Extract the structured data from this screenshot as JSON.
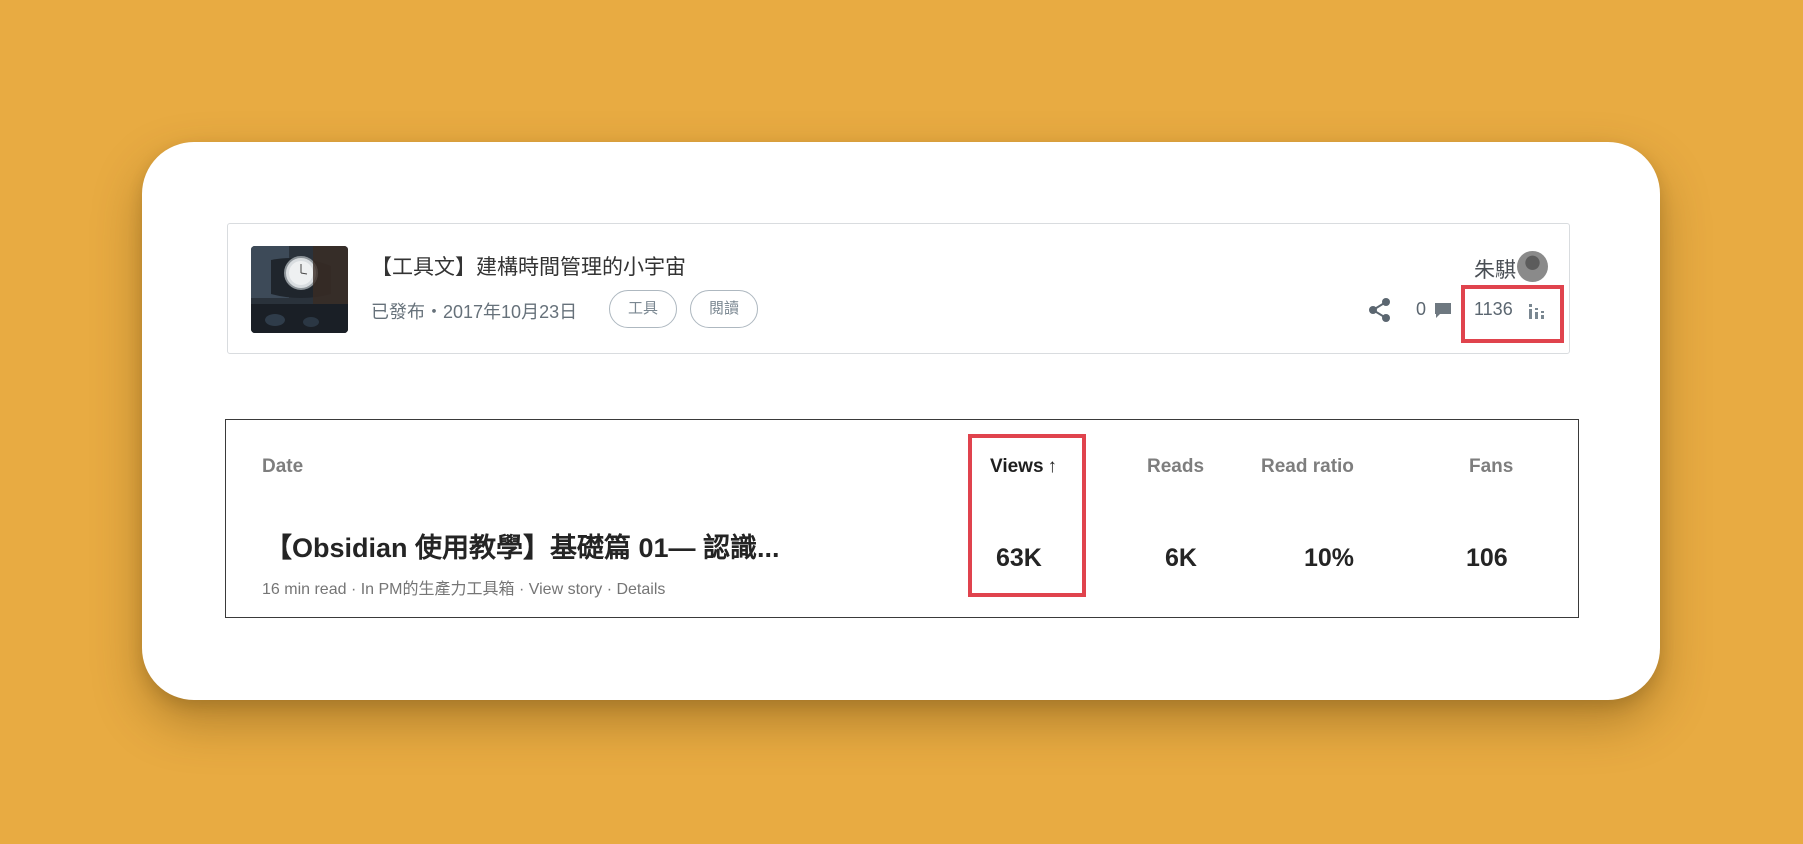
{
  "post": {
    "title": "【工具文】建構時間管理的小宇宙",
    "meta": "已發布・2017年10月23日",
    "tags": [
      "工具",
      "閱讀"
    ],
    "author": "朱騏",
    "comment_count": "0",
    "view_count": "1136"
  },
  "stats_table": {
    "headers": {
      "date": "Date",
      "views": "Views",
      "views_sort_arrow": "↑",
      "reads": "Reads",
      "read_ratio": "Read ratio",
      "fans": "Fans"
    },
    "row": {
      "title": "【Obsidian 使用教學】基礎篇 01— 認識...",
      "read_time": "16 min read",
      "publication": "In PM的生產力工具箱",
      "view_story": "View story",
      "details": "Details",
      "separator": " · ",
      "views": "63K",
      "reads": "6K",
      "read_ratio": "10%",
      "fans": "106"
    }
  },
  "colors": {
    "background": "#E8AB42",
    "card": "#FFFFFF",
    "highlight": "#E0434D"
  },
  "icons": [
    "share-icon",
    "comment-icon",
    "stats-icon",
    "avatar",
    "sort-arrow-up-icon"
  ]
}
